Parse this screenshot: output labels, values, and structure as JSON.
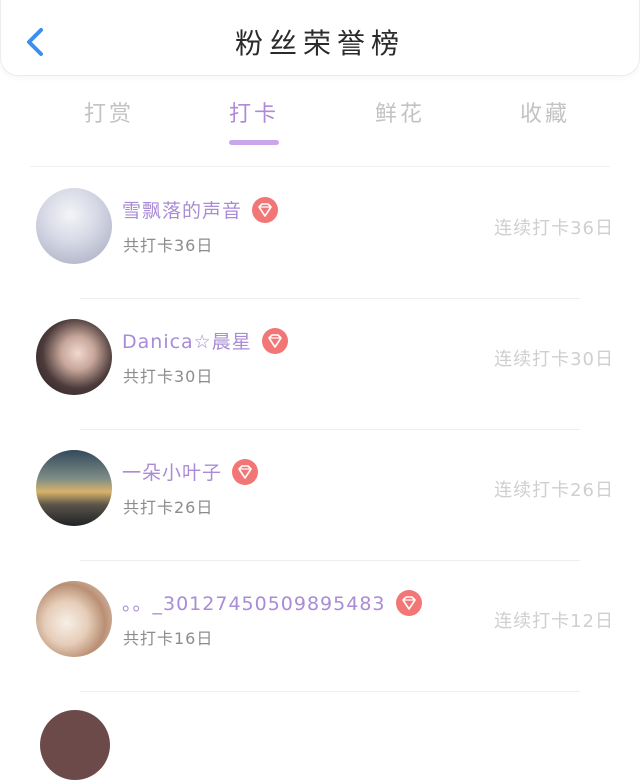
{
  "header": {
    "title": "粉丝荣誉榜",
    "back_icon": "chevron-left-icon",
    "accent": "#3b8ff0"
  },
  "tabs": [
    {
      "label": "打赏",
      "active": false
    },
    {
      "label": "打卡",
      "active": true
    },
    {
      "label": "鲜花",
      "active": false
    },
    {
      "label": "收藏",
      "active": false
    }
  ],
  "colors": {
    "name": "#a98bd6",
    "badge": "#f27676",
    "tab_active": "#b08ad6",
    "tab_inactive": "#c3c3c3"
  },
  "rows": [
    {
      "name": "雪飘落的声音",
      "total": "共打卡36日",
      "streak": "连续打卡36日",
      "badge_icon": "diamond-icon"
    },
    {
      "name": "Danica☆晨星",
      "total": "共打卡30日",
      "streak": "连续打卡30日",
      "badge_icon": "diamond-icon"
    },
    {
      "name": "一朵小叶子",
      "total": "共打卡26日",
      "streak": "连续打卡26日",
      "badge_icon": "diamond-icon"
    },
    {
      "name": "。。_30127450509895483",
      "total": "共打卡16日",
      "streak": "连续打卡12日",
      "badge_icon": "diamond-icon"
    }
  ]
}
